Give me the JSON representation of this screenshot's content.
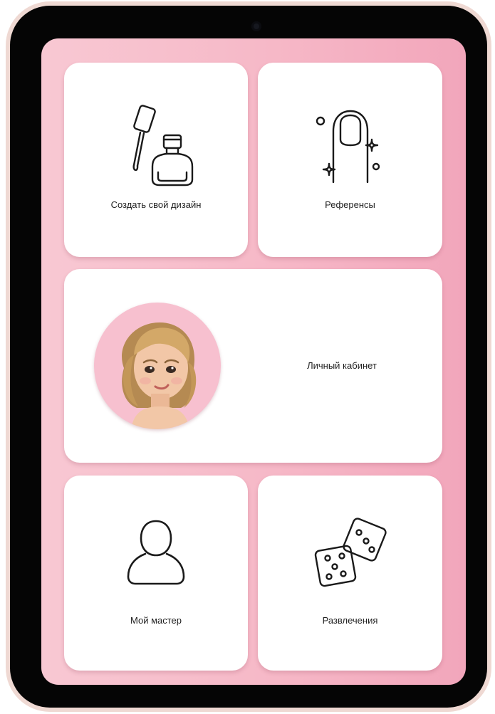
{
  "menu": {
    "create_design": {
      "label": "Создать свой дизайн",
      "icon": "nail-polish-icon"
    },
    "references": {
      "label": "Референсы",
      "icon": "nail-sparkle-icon"
    },
    "cabinet": {
      "label": "Личный кабинет",
      "icon": "avatar"
    },
    "my_master": {
      "label": "Мой мастер",
      "icon": "person-icon"
    },
    "entertainment": {
      "label": "Развлечения",
      "icon": "dice-icon"
    }
  },
  "colors": {
    "screen_background": "#f6b8c7",
    "card_background": "#ffffff",
    "avatar_background": "#f7c0cf",
    "bezel": "#050505"
  }
}
